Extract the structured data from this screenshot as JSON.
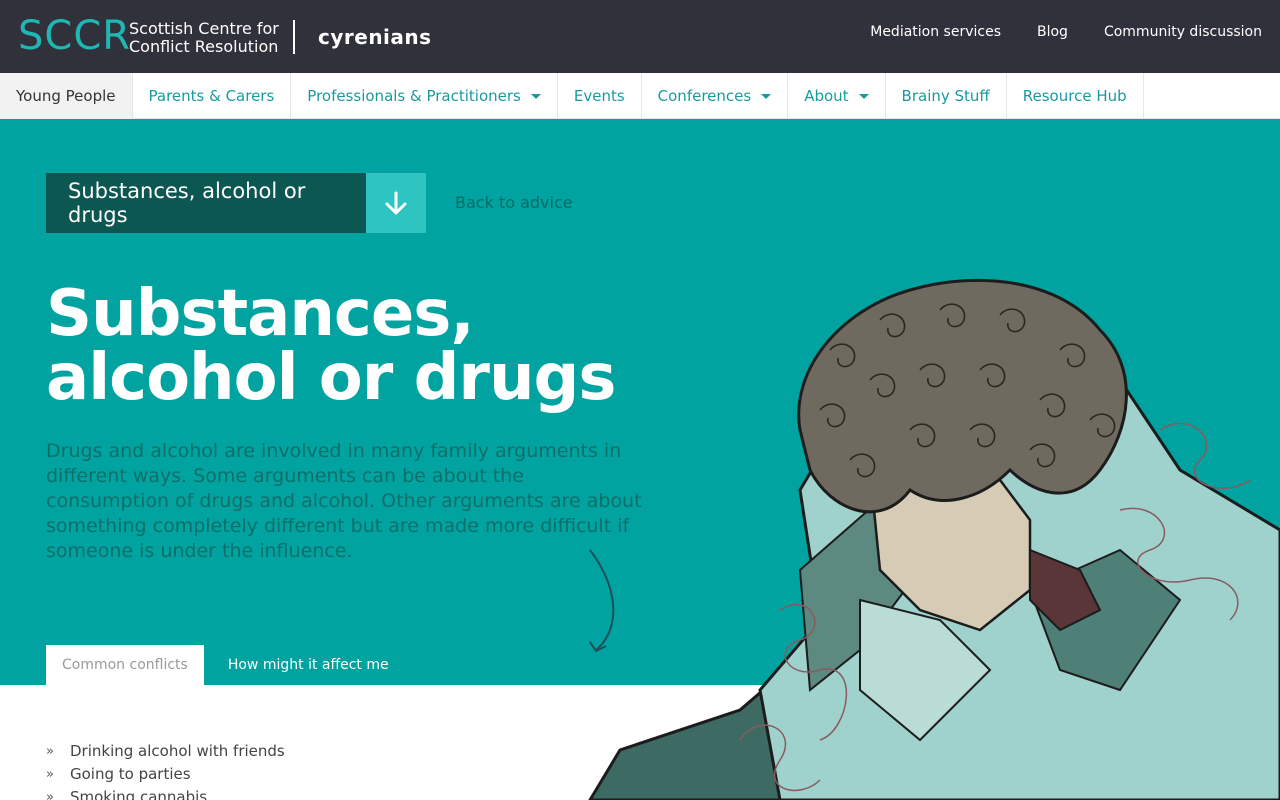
{
  "brand": {
    "logo_short": "SCCR",
    "logo_line1": "Scottish Centre for",
    "logo_line2": "Conflict Resolution",
    "partner": "cyrenians"
  },
  "topnav": [
    "Mediation services",
    "Blog",
    "Community discussion"
  ],
  "mainnav": [
    {
      "label": "Young People",
      "dropdown": false,
      "active": true
    },
    {
      "label": "Parents & Carers",
      "dropdown": false,
      "active": false
    },
    {
      "label": "Professionals & Practitioners",
      "dropdown": true,
      "active": false
    },
    {
      "label": "Events",
      "dropdown": false,
      "active": false
    },
    {
      "label": "Conferences",
      "dropdown": true,
      "active": false
    },
    {
      "label": "About",
      "dropdown": true,
      "active": false
    },
    {
      "label": "Brainy Stuff",
      "dropdown": false,
      "active": false
    },
    {
      "label": "Resource Hub",
      "dropdown": false,
      "active": false
    }
  ],
  "hero": {
    "dropdown_label": "Substances, alcohol or drugs",
    "back_link": "Back to advice",
    "title_line1": "Substances,",
    "title_line2": "alcohol or drugs",
    "description": "Drugs and alcohol are involved in many family arguments in different ways. Some arguments can be about the consumption of drugs and alcohol. Other arguments are about something completely different but are made more difficult if someone is under the influence."
  },
  "tabs": [
    {
      "label": "Common conflicts",
      "active": true
    },
    {
      "label": "How might it affect me",
      "active": false
    }
  ],
  "conflicts": [
    "Drinking alcohol with friends",
    "Going to parties",
    "Smoking cannabis"
  ],
  "colors": {
    "topbar": "#31313b",
    "hero": "#00a39f",
    "accent": "#1fb7b4",
    "dark_teal": "#0d5753"
  },
  "icons": {
    "dropdown": "arrow-down-icon",
    "caret": "caret-down-icon",
    "bullet": "»"
  }
}
